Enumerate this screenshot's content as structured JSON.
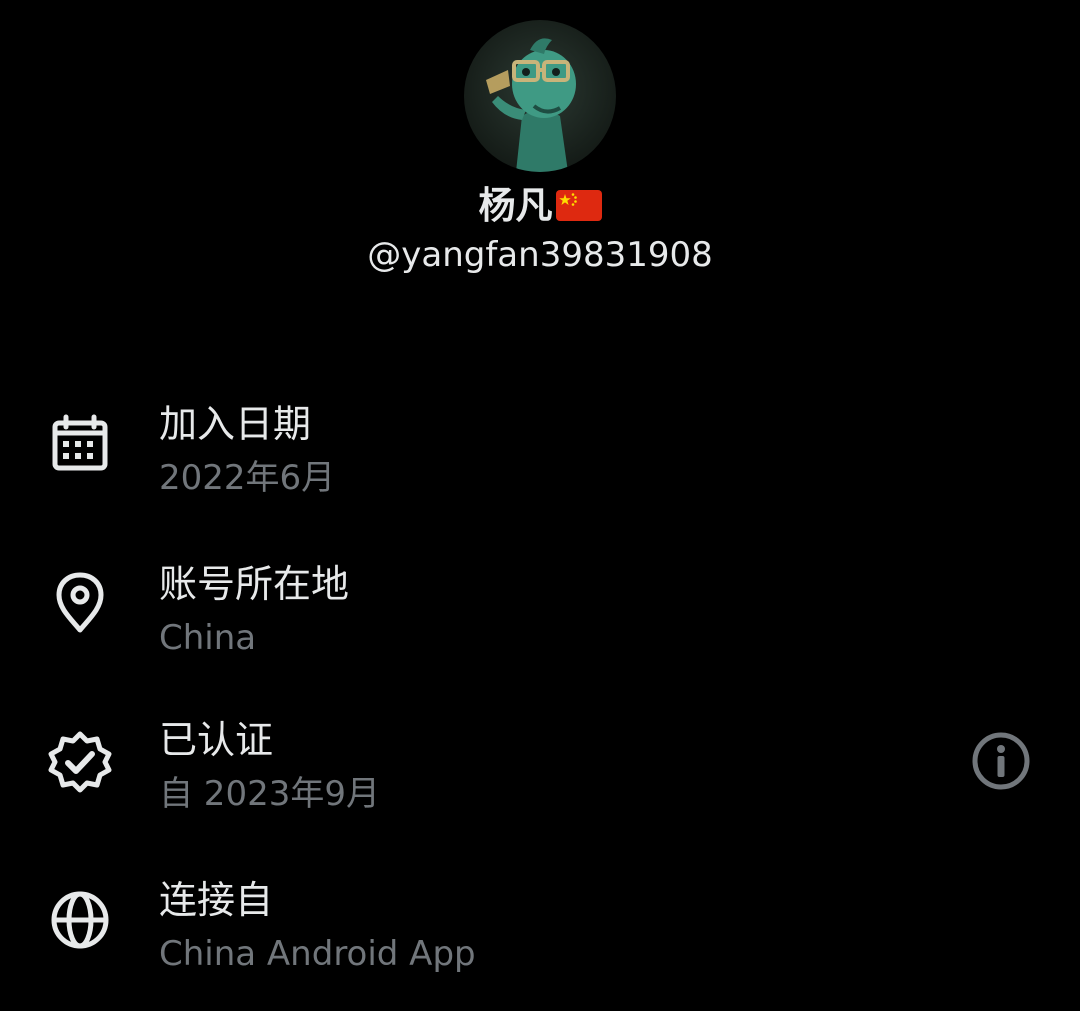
{
  "profile": {
    "display_name": "杨凡",
    "flag_icon": "china-flag-icon",
    "handle": "@yangfan39831908",
    "avatar_icon": "avatar-green-figure"
  },
  "info": {
    "join_date": {
      "icon": "calendar-icon",
      "title": "加入日期",
      "value": "2022年6月"
    },
    "location": {
      "icon": "location-pin-icon",
      "title": "账号所在地",
      "value": "China"
    },
    "verified": {
      "icon": "verified-badge-icon",
      "title": "已认证",
      "value": "自 2023年9月",
      "action_icon": "info-icon"
    },
    "connected_via": {
      "icon": "globe-icon",
      "title": "连接自",
      "value": "China Android App"
    }
  },
  "colors": {
    "background": "#000000",
    "primary_text": "#e7e9ea",
    "secondary_text": "#71767b",
    "icon": "#e7e9ea",
    "info_icon": "#71767b"
  }
}
